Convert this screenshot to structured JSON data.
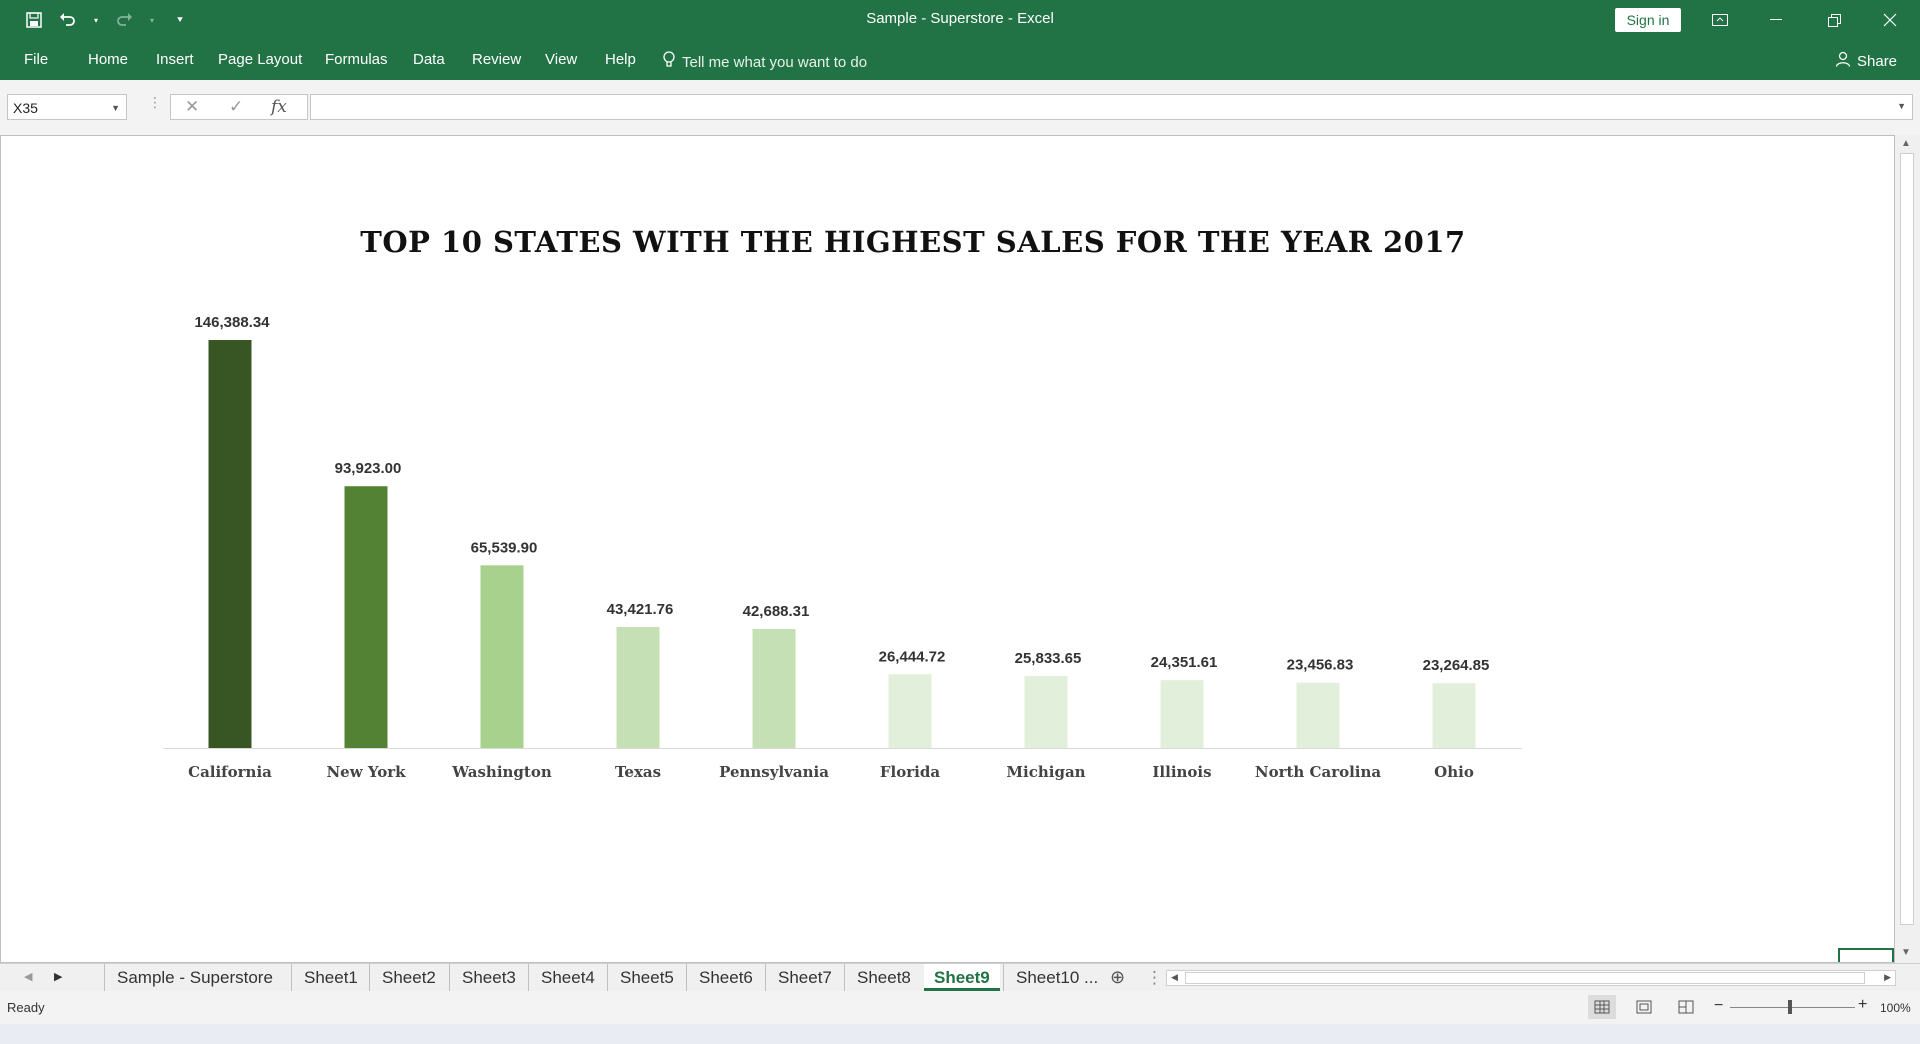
{
  "window": {
    "title": "Sample - Superstore  -  Excel",
    "sign_in": "Sign in"
  },
  "menu": {
    "items": [
      "File",
      "Home",
      "Insert",
      "Page Layout",
      "Formulas",
      "Data",
      "Review",
      "View",
      "Help"
    ],
    "tell_me": "Tell me what you want to do",
    "share": "Share"
  },
  "formula_bar": {
    "name_box": "X35",
    "fx": "fx",
    "value": ""
  },
  "chart_data": {
    "type": "bar",
    "title": "TOP 10 STATES WITH THE HIGHEST SALES FOR THE YEAR 2017",
    "categories": [
      "California",
      "New York",
      "Washington",
      "Texas",
      "Pennsylvania",
      "Florida",
      "Michigan",
      "Illinois",
      "North Carolina",
      "Ohio"
    ],
    "values": [
      146388.34,
      93923.0,
      65539.9,
      43421.76,
      42688.31,
      26444.72,
      25833.65,
      24351.61,
      23456.83,
      23264.85
    ],
    "data_labels": [
      "146,388.34",
      "93,923.00",
      "65,539.90",
      "43,421.76",
      "42,688.31",
      "26,444.72",
      "25,833.65",
      "24,351.61",
      "23,456.83",
      "23,264.85"
    ],
    "bar_colors": [
      "#375623",
      "#548235",
      "#a9d18e",
      "#c5e0b4",
      "#c5e0b4",
      "#e2efda",
      "#e2efda",
      "#e2efda",
      "#e2efda",
      "#e2efda"
    ],
    "ylim": [
      0,
      146388.34
    ],
    "grid": false,
    "legend": "none"
  },
  "sheet_tabs": {
    "tabs": [
      "Sample - Superstore",
      "Sheet1",
      "Sheet2",
      "Sheet3",
      "Sheet4",
      "Sheet5",
      "Sheet6",
      "Sheet7",
      "Sheet8",
      "Sheet9",
      "Sheet10 ..."
    ],
    "active": "Sheet9"
  },
  "status": {
    "text": "Ready",
    "zoom": "100%"
  },
  "colors": {
    "accent": "#217346"
  }
}
